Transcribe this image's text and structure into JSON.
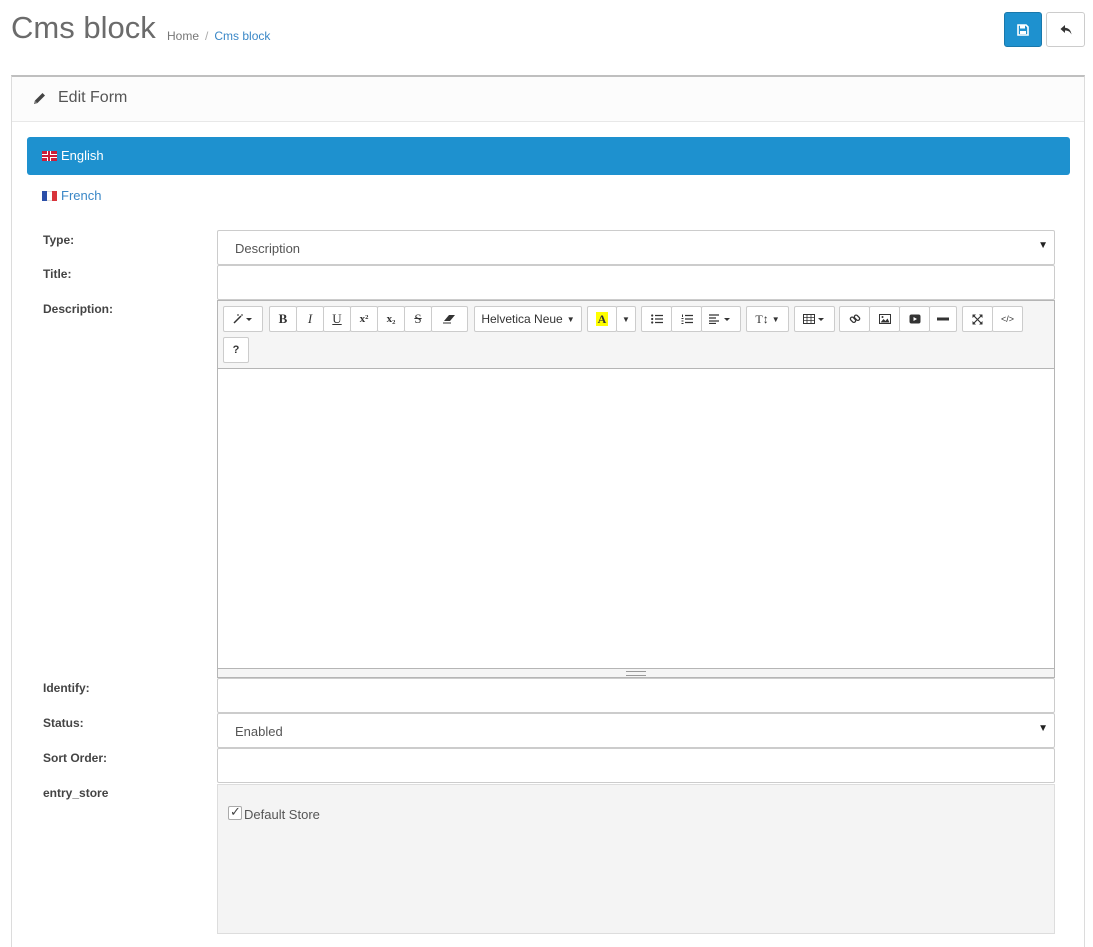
{
  "header": {
    "title": "Cms block",
    "breadcrumb": [
      "Home",
      "Cms block"
    ],
    "breadcrumb_separator": "/",
    "save_icon": "save-icon",
    "back_icon": "reply-icon"
  },
  "panel": {
    "heading": "Edit Form",
    "heading_icon": "pencil-icon"
  },
  "languages": [
    {
      "label": "English",
      "flag": "flag-uk-icon",
      "active": true
    },
    {
      "label": "French",
      "flag": "flag-fr-icon",
      "active": false
    }
  ],
  "form": {
    "type_label": "Type:",
    "type_value": "Description",
    "title_label": "Title:",
    "title_value": "",
    "description_label": "Description:",
    "identify_label": "Identify:",
    "identify_value": "",
    "status_label": "Status:",
    "status_value": "Enabled",
    "sort_order_label": "Sort Order:",
    "sort_order_value": "",
    "store_label": "entry_store",
    "store_option": "Default Store",
    "store_checked": true
  },
  "editor_toolbar": {
    "font_name": "Helvetica Neue",
    "buttons": [
      "style",
      "bold",
      "italic",
      "underline",
      "superscript",
      "subscript",
      "strikethrough",
      "clear-format",
      "font-family",
      "color",
      "color-dropdown",
      "unordered-list",
      "ordered-list",
      "paragraph-align",
      "line-height",
      "table",
      "link",
      "picture",
      "video",
      "horizontal-rule",
      "fullscreen",
      "code-view",
      "help"
    ],
    "help_label": "?"
  },
  "colors": {
    "primary": "#1e91cf",
    "link": "#3a87c7",
    "store_bg": "#f4f4f4"
  }
}
